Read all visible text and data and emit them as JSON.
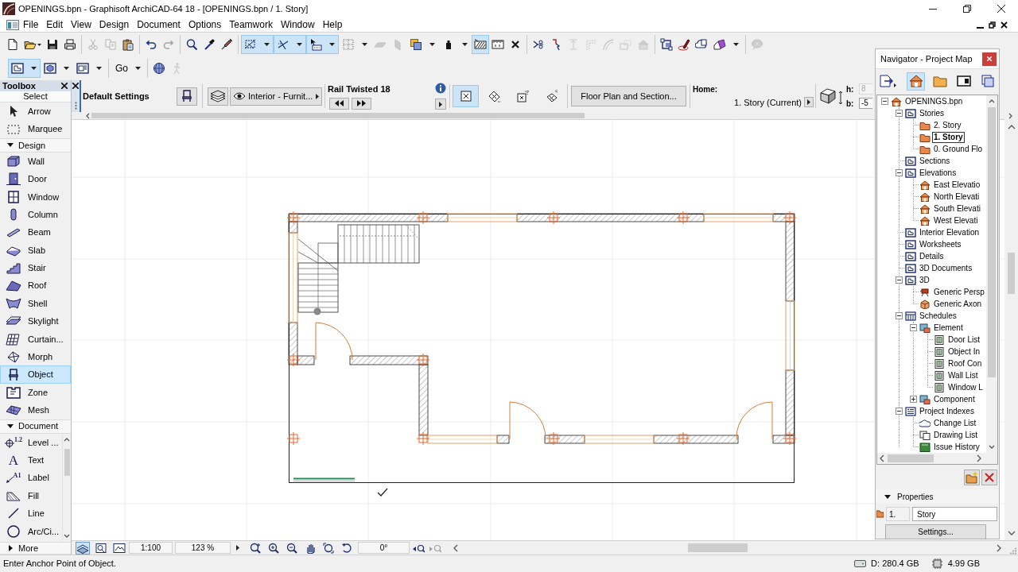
{
  "window": {
    "title": "OPENINGS.bpn - Graphisoft ArchiCAD-64 18 - [OPENINGS.bpn / 1. Story]"
  },
  "menu": [
    "File",
    "Edit",
    "View",
    "Design",
    "Document",
    "Options",
    "Teamwork",
    "Window",
    "Help"
  ],
  "toolbars": [
    [
      [
        {
          "kind": "plain",
          "on": false,
          "disabled": false
        },
        {
          "kind": "mini-split",
          "on": false,
          "disabled": false
        },
        {
          "kind": "plain",
          "on": false,
          "disabled": false
        },
        {
          "kind": "plain",
          "on": false,
          "disabled": false
        }
      ],
      [
        {
          "kind": "plain",
          "on": false,
          "disabled": true
        },
        {
          "kind": "plain",
          "on": false,
          "disabled": true
        },
        {
          "kind": "plain",
          "on": false,
          "disabled": false
        }
      ],
      [
        {
          "kind": "plain",
          "on": false,
          "disabled": false
        },
        {
          "kind": "plain",
          "on": false,
          "disabled": true
        }
      ],
      [
        {
          "kind": "plain",
          "on": false,
          "disabled": false
        },
        {
          "kind": "plain",
          "on": false,
          "disabled": false
        },
        {
          "kind": "plain",
          "on": false,
          "disabled": false
        }
      ],
      [
        {
          "kind": "split",
          "on": true,
          "disabled": false
        },
        {
          "kind": "split",
          "on": true,
          "disabled": false
        },
        {
          "kind": "split",
          "on": true,
          "disabled": false
        },
        {
          "kind": "split",
          "on": false,
          "disabled": false
        },
        {
          "kind": "plain",
          "on": false,
          "disabled": true
        },
        {
          "kind": "plain",
          "on": false,
          "disabled": true
        },
        {
          "kind": "split",
          "on": false,
          "disabled": false
        },
        {
          "kind": "split",
          "on": false,
          "disabled": false
        },
        {
          "kind": "plain",
          "on": true,
          "disabled": false
        },
        {
          "kind": "plain",
          "on": false,
          "disabled": false
        },
        {
          "kind": "plain",
          "on": false,
          "disabled": false
        }
      ],
      [
        {
          "kind": "plain",
          "on": false,
          "disabled": false
        },
        {
          "kind": "plain",
          "on": false,
          "disabled": false
        },
        {
          "kind": "plain",
          "on": false,
          "disabled": true
        },
        {
          "kind": "plain",
          "on": false,
          "disabled": true
        },
        {
          "kind": "plain",
          "on": false,
          "disabled": true
        },
        {
          "kind": "plain",
          "on": false,
          "disabled": true
        },
        {
          "kind": "plain",
          "on": false,
          "disabled": true
        }
      ],
      [
        {
          "kind": "plain",
          "on": false,
          "disabled": false
        },
        {
          "kind": "plain",
          "on": false,
          "disabled": false
        },
        {
          "kind": "plain",
          "on": false,
          "disabled": false
        },
        {
          "kind": "split",
          "on": false,
          "disabled": false
        }
      ],
      [
        {
          "kind": "plain",
          "on": false,
          "disabled": true
        }
      ]
    ],
    [
      [
        {
          "kind": "split",
          "on": true,
          "disabled": false
        },
        {
          "kind": "split",
          "on": false,
          "disabled": false
        },
        {
          "kind": "split",
          "on": false,
          "disabled": false
        }
      ],
      [
        {
          "kind": "label",
          "label": "Go",
          "on": false,
          "disabled": false
        }
      ],
      [
        {
          "kind": "plain",
          "on": false,
          "disabled": false
        },
        {
          "kind": "plain",
          "on": false,
          "disabled": true
        }
      ]
    ]
  ],
  "toolbox": {
    "title": "Toolbox",
    "sections": [
      {
        "label": "Select",
        "kind": "fixed",
        "tools": [
          {
            "label": "Arrow",
            "selected": false
          },
          {
            "label": "Marquee",
            "selected": false
          }
        ]
      },
      {
        "label": "Design",
        "kind": "collapsible",
        "expanded": true,
        "tools": [
          {
            "label": "Wall",
            "selected": false
          },
          {
            "label": "Door",
            "selected": false
          },
          {
            "label": "Window",
            "selected": false
          },
          {
            "label": "Column",
            "selected": false
          },
          {
            "label": "Beam",
            "selected": false
          },
          {
            "label": "Slab",
            "selected": false
          },
          {
            "label": "Stair",
            "selected": false
          },
          {
            "label": "Roof",
            "selected": false
          },
          {
            "label": "Shell",
            "selected": false
          },
          {
            "label": "Skylight",
            "selected": false
          },
          {
            "label": "Curtain...",
            "selected": false
          },
          {
            "label": "Morph",
            "selected": false
          },
          {
            "label": "Object",
            "selected": true
          },
          {
            "label": "Zone",
            "selected": false
          },
          {
            "label": "Mesh",
            "selected": false
          }
        ]
      },
      {
        "label": "Document",
        "kind": "collapsible",
        "expanded": true,
        "tools": [
          {
            "label": "Level ...",
            "icon_text": "1.2",
            "selected": false
          },
          {
            "label": "Text",
            "icon_text": "A",
            "selected": false
          },
          {
            "label": "Label",
            "icon_text": "A1",
            "selected": false
          },
          {
            "label": "Fill",
            "selected": false
          },
          {
            "label": "Line",
            "selected": false
          },
          {
            "label": "Arc/Ci...",
            "selected": false
          }
        ]
      },
      {
        "label": "More",
        "kind": "collapsible",
        "expanded": false
      }
    ]
  },
  "info_box": {
    "title": "Default Settings",
    "layer": "Interior - Furnit...",
    "element_name": "Rail Twisted 18",
    "geometry_options": [
      {
        "selected": true
      },
      {
        "selected": false
      },
      {
        "selected": false
      },
      {
        "selected": false
      }
    ],
    "view_button": "Floor Plan and Section...",
    "home_label": "Home:",
    "home_story": "1. Story (Current)",
    "fields": [
      {
        "label": "h:",
        "value": "8",
        "disabled": true
      },
      {
        "label": "b:",
        "value": "-5",
        "disabled": false
      }
    ]
  },
  "navigator": {
    "title": "Navigator - Project Map",
    "tabs": [
      {
        "selected": true
      },
      {
        "selected": false
      },
      {
        "selected": false
      },
      {
        "selected": false
      }
    ],
    "tree": [
      {
        "label": "OPENINGS.bpn",
        "kind": "project",
        "expanded": true,
        "selected": false,
        "children": [
          {
            "label": "Stories",
            "kind": "folder",
            "expanded": true,
            "selected": false,
            "children": [
              {
                "label": "2. Story",
                "kind": "story",
                "selected": false
              },
              {
                "label": "1. Story",
                "kind": "story",
                "selected": true
              },
              {
                "label": "0. Ground Flo",
                "kind": "story",
                "selected": false
              }
            ]
          },
          {
            "label": "Sections",
            "kind": "folder",
            "selected": false
          },
          {
            "label": "Elevations",
            "kind": "folder",
            "expanded": true,
            "selected": false,
            "children": [
              {
                "label": "East Elevatio",
                "kind": "elevation",
                "selected": false
              },
              {
                "label": "North Elevati",
                "kind": "elevation",
                "selected": false
              },
              {
                "label": "South Elevati",
                "kind": "elevation",
                "selected": false
              },
              {
                "label": "West Elevati",
                "kind": "elevation",
                "selected": false
              }
            ]
          },
          {
            "label": "Interior Elevation",
            "kind": "folder",
            "selected": false
          },
          {
            "label": "Worksheets",
            "kind": "folder",
            "selected": false
          },
          {
            "label": "Details",
            "kind": "folder",
            "selected": false
          },
          {
            "label": "3D Documents",
            "kind": "folder",
            "selected": false
          },
          {
            "label": "3D",
            "kind": "folder",
            "expanded": true,
            "selected": false,
            "children": [
              {
                "label": "Generic Persp",
                "kind": "camera",
                "selected": false
              },
              {
                "label": "Generic Axon",
                "kind": "box",
                "selected": false
              }
            ]
          },
          {
            "label": "Schedules",
            "kind": "table",
            "expanded": true,
            "selected": false,
            "children": [
              {
                "label": "Element",
                "kind": "group",
                "expanded": true,
                "selected": false,
                "children": [
                  {
                    "label": "Door List",
                    "kind": "list",
                    "selected": false
                  },
                  {
                    "label": "Object In",
                    "kind": "list",
                    "selected": false
                  },
                  {
                    "label": "Roof Con",
                    "kind": "list",
                    "selected": false
                  },
                  {
                    "label": "Wall List",
                    "kind": "list",
                    "selected": false
                  },
                  {
                    "label": "Window L",
                    "kind": "list",
                    "selected": false
                  }
                ]
              },
              {
                "label": "Component",
                "kind": "group",
                "expanded": false,
                "selected": false
              }
            ]
          },
          {
            "label": "Project Indexes",
            "kind": "index",
            "expanded": true,
            "selected": false,
            "children": [
              {
                "label": "Change List",
                "kind": "cloud",
                "selected": false
              },
              {
                "label": "Drawing List",
                "kind": "pages",
                "selected": false
              },
              {
                "label": "Issue History",
                "kind": "book",
                "selected": false
              }
            ]
          }
        ]
      }
    ],
    "properties": {
      "title": "Properties",
      "expanded": true,
      "story_number": "1.",
      "story_name": "Story",
      "settings_button": "Settings..."
    }
  },
  "view_bar": {
    "quick_options": [
      {
        "on": true
      },
      {
        "on": false
      },
      {
        "on": false
      }
    ],
    "scale": "1:100",
    "zoom": "123 %",
    "navigation": [
      {
        "disabled": false
      },
      {
        "disabled": false
      },
      {
        "disabled": false
      },
      {
        "disabled": false
      },
      {
        "disabled": false
      },
      {
        "disabled": false
      }
    ],
    "angle": "0°",
    "zoom_history": [
      {
        "disabled": false
      },
      {
        "disabled": true
      }
    ]
  },
  "status_bar": {
    "prompt": "Enter Anchor Point of Object.",
    "disk": "D: 280.4 GB",
    "memory": "4.99 GB"
  }
}
